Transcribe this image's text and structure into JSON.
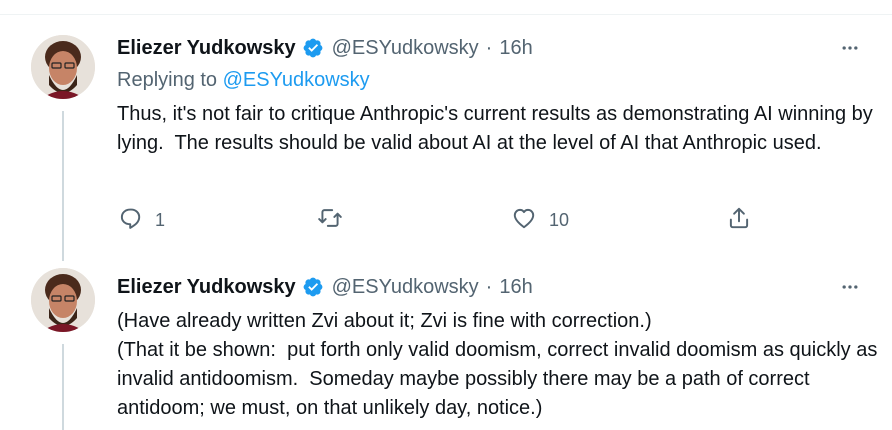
{
  "tweets": [
    {
      "name": "Eliezer Yudkowsky",
      "handle": "@ESYudkowsky",
      "separator": "·",
      "time": "16h",
      "replying_prefix": "Replying to ",
      "replying_to": "@ESYudkowsky",
      "text": "Thus, it's not fair to critique Anthropic's current results as demonstrating AI winning by lying.  The results should be valid about AI at the level of AI that Anthropic used.",
      "actions": {
        "reply_count": "1",
        "retweet_count": "",
        "like_count": "10"
      }
    },
    {
      "name": "Eliezer Yudkowsky",
      "handle": "@ESYudkowsky",
      "separator": "·",
      "time": "16h",
      "text": "(Have already written Zvi about it; Zvi is fine with correction.)\n(That it be shown:  put forth only valid doomism, correct invalid doomism as quickly as invalid antidoomism.  Someday maybe possibly there may be a path of correct antidoom; we must, on that unlikely day, notice.)"
    }
  ],
  "colors": {
    "accent": "#1d9bf0",
    "secondary_text": "#536471",
    "thread_line": "#cfd9de"
  },
  "icons": [
    "verified-badge-icon",
    "more-icon",
    "reply-icon",
    "retweet-icon",
    "like-icon",
    "share-icon"
  ]
}
